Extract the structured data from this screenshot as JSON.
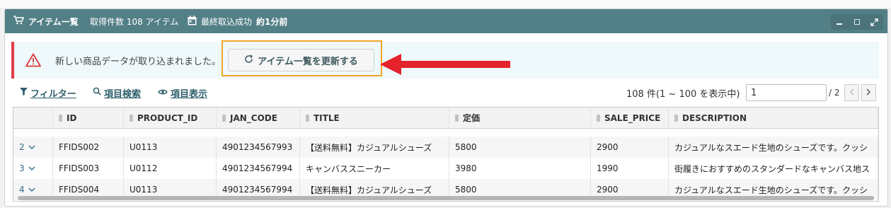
{
  "window": {
    "title": "アイテム一覧",
    "count_label": "取得件数 108 アイテム",
    "last_sync_label": "最終取込成功",
    "last_sync_value": "約1分前"
  },
  "alert": {
    "message": "新しい商品データが取り込まれました。",
    "refresh_button": "アイテム一覧を更新する"
  },
  "toolbar": {
    "filter": "フィルター",
    "search": "項目検索",
    "display": "項目表示"
  },
  "pager": {
    "info": "108 件(1 ~ 100 を表示中)",
    "page_value": "1",
    "total": "/ 2"
  },
  "table": {
    "columns": [
      "ID",
      "PRODUCT_ID",
      "JAN_CODE",
      "TITLE",
      "定価",
      "SALE_PRICE",
      "DESCRIPTION"
    ],
    "rows": [
      {
        "num": "2",
        "id": "FFIDS002",
        "product_id": "U0113",
        "jan": "4901234567993",
        "title": "【送料無料】カジュアルシューズ",
        "price": "5800",
        "sale": "2900",
        "desc": "カジュアルなスエード生地のシューズです。クッシ"
      },
      {
        "num": "3",
        "id": "FFIDS003",
        "product_id": "U0112",
        "jan": "4901234567994",
        "title": "キャンバススニーカー",
        "price": "3980",
        "sale": "1990",
        "desc": "街履きにおすすめのスタンダードなキャンバス地ス"
      },
      {
        "num": "4",
        "id": "FFIDS004",
        "product_id": "U0113",
        "jan": "4901234567994",
        "title": "【送料無料】カジュアルシューズ",
        "price": "5800",
        "sale": "2900",
        "desc": "カジュアルなスエード生地のシューズです。クッシ"
      }
    ]
  },
  "colors": {
    "titlebar": "#537f86",
    "alert_border": "#e03b4a",
    "highlight": "#f2a623",
    "arrow": "#e3222b",
    "link": "#2e5f6b"
  },
  "icons": [
    "cart-icon",
    "calendar-icon",
    "minimize-icon",
    "maximize-icon",
    "fullscreen-icon",
    "warning-icon",
    "refresh-icon",
    "filter-icon",
    "search-icon",
    "eye-icon",
    "chevron-down-icon",
    "chevron-left-icon",
    "chevron-right-icon",
    "pin-icon"
  ]
}
